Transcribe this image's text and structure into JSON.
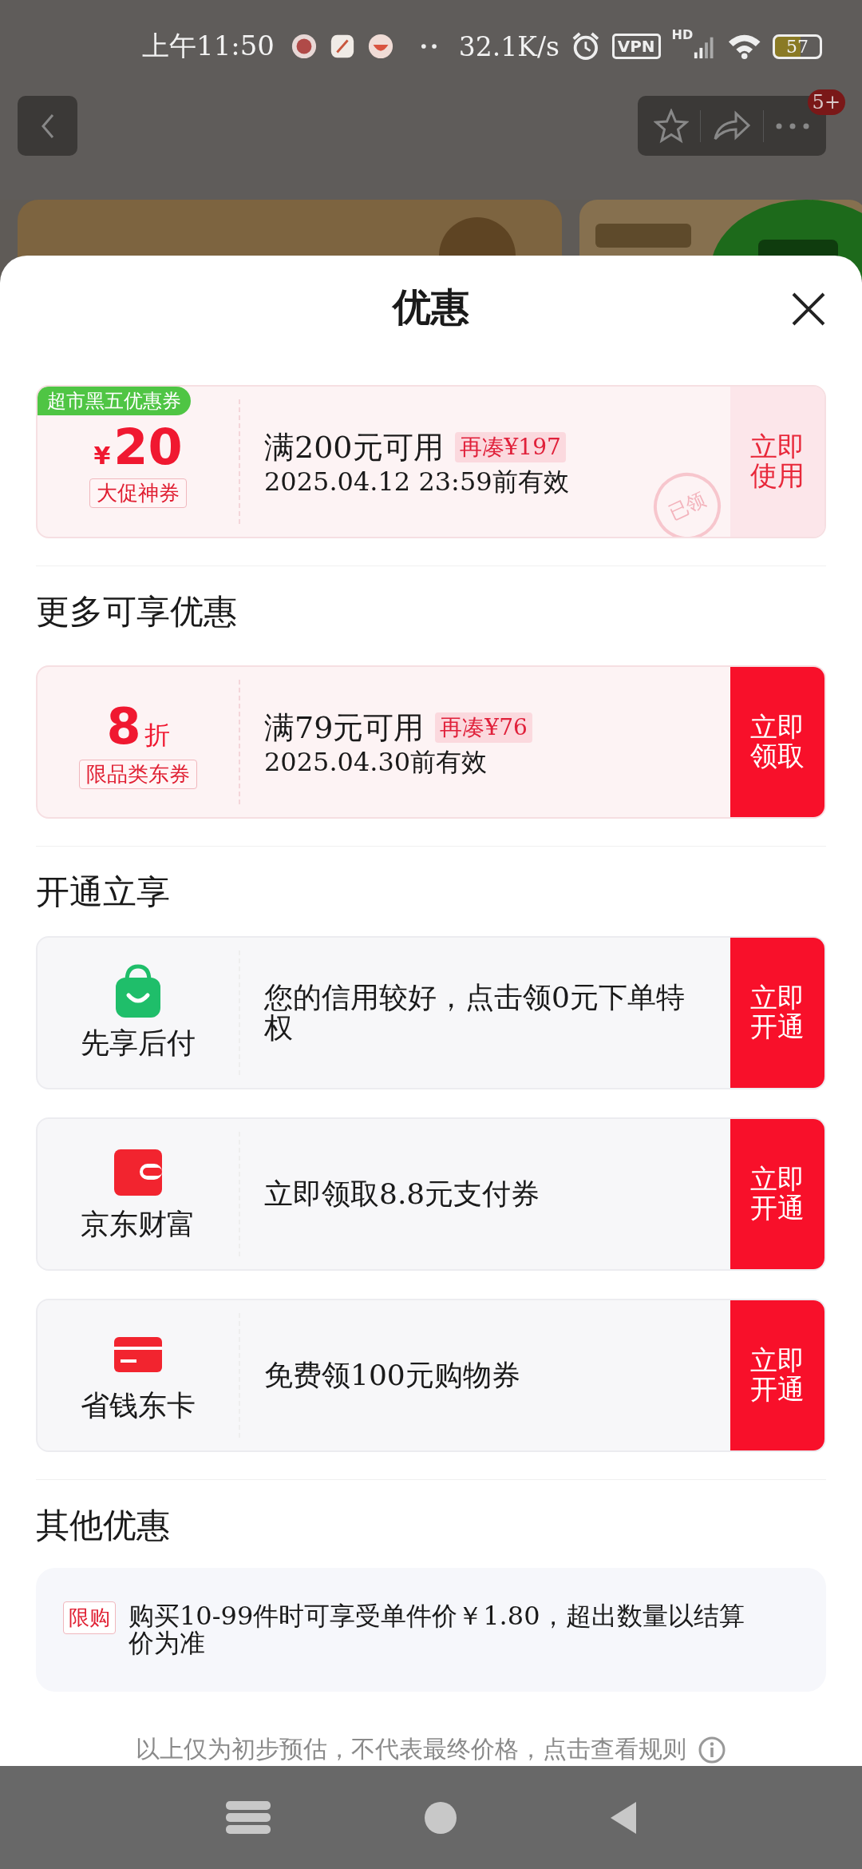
{
  "status_bar": {
    "time": "上午11:50",
    "speed": "32.1K/s",
    "vpn": "VPN",
    "network": "HD",
    "battery": "57"
  },
  "top_bar": {
    "badge": "5+"
  },
  "sheet": {
    "title": "优惠"
  },
  "coupons": [
    {
      "kind": "amount",
      "tag": "超市黑五优惠券",
      "currency": "¥",
      "value": "20",
      "label": "大促神券",
      "condition": "满200元可用",
      "gap": "再凑¥197",
      "validity": "2025.04.12 23:59前有效",
      "button": "立即使用",
      "claimed": true,
      "stamp": "已领"
    }
  ],
  "more_heading": "更多可享优惠",
  "more_coupons": [
    {
      "kind": "discount",
      "value": "8",
      "unit": "折",
      "label": "限品类东券",
      "condition": "满79元可用",
      "gap": "再凑¥76",
      "validity": "2025.04.30前有效",
      "button": "立即领取",
      "claimed": false
    }
  ],
  "services_heading": "开通立享",
  "services": [
    {
      "name": "先享后付",
      "text": "您的信用较好，点击领0元下单特权",
      "button": "立即开通"
    },
    {
      "name": "京东财富",
      "text": "立即领取8.8元支付券",
      "button": "立即开通"
    },
    {
      "name": "省钱东卡",
      "text": "免费领100元购物券",
      "button": "立即开通"
    }
  ],
  "other_heading": "其他优惠",
  "other": [
    {
      "tag": "限购",
      "text": "购买10-99件时可享受单件价￥1.80，超出数量以结算价为准"
    }
  ],
  "footer_note": "以上仅为初步预估，不代表最终价格，点击查看规则"
}
